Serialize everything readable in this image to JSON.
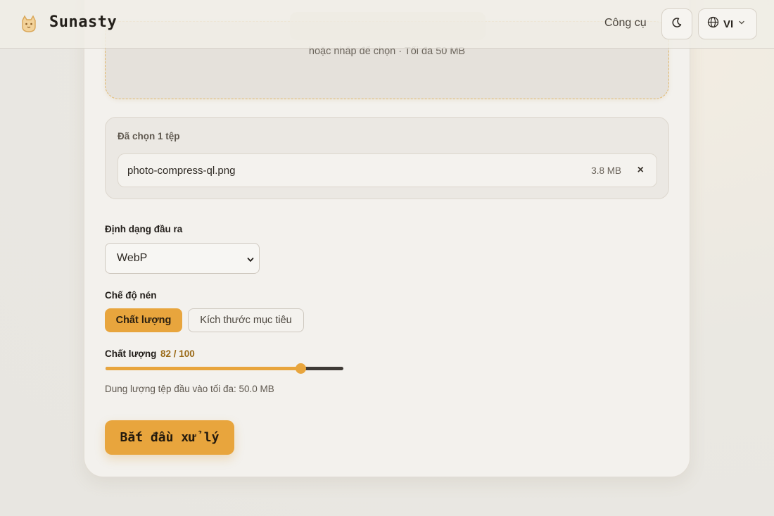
{
  "header": {
    "brand": "Sunasty",
    "nav_tools": "Công cụ",
    "language_code": "VI"
  },
  "dropzone": {
    "hint": "hoặc nhấp để chọn · Tối đa 50 MB"
  },
  "files": {
    "title": "Đã chọn 1 tệp",
    "items": [
      {
        "name": "photo-compress-ql.png",
        "size": "3.8 MB",
        "remove_label": "×"
      }
    ]
  },
  "output_format": {
    "label": "Định dạng đầu ra",
    "selected": "WebP"
  },
  "compression_mode": {
    "label": "Chế độ nén",
    "options": [
      "Chất lượng",
      "Kích thước mục tiêu"
    ],
    "active_index": 0
  },
  "quality": {
    "label": "Chất lượng",
    "value_text": "82 / 100",
    "value": 82,
    "max": 100
  },
  "max_input_note": "Dung lượng tệp đầu vào tối đa: 50.0 MB",
  "start_button": "Bắt đầu xử lý",
  "colors": {
    "accent": "#e8a53d",
    "background": "#e8e6e1",
    "card": "#f3f1ed"
  }
}
